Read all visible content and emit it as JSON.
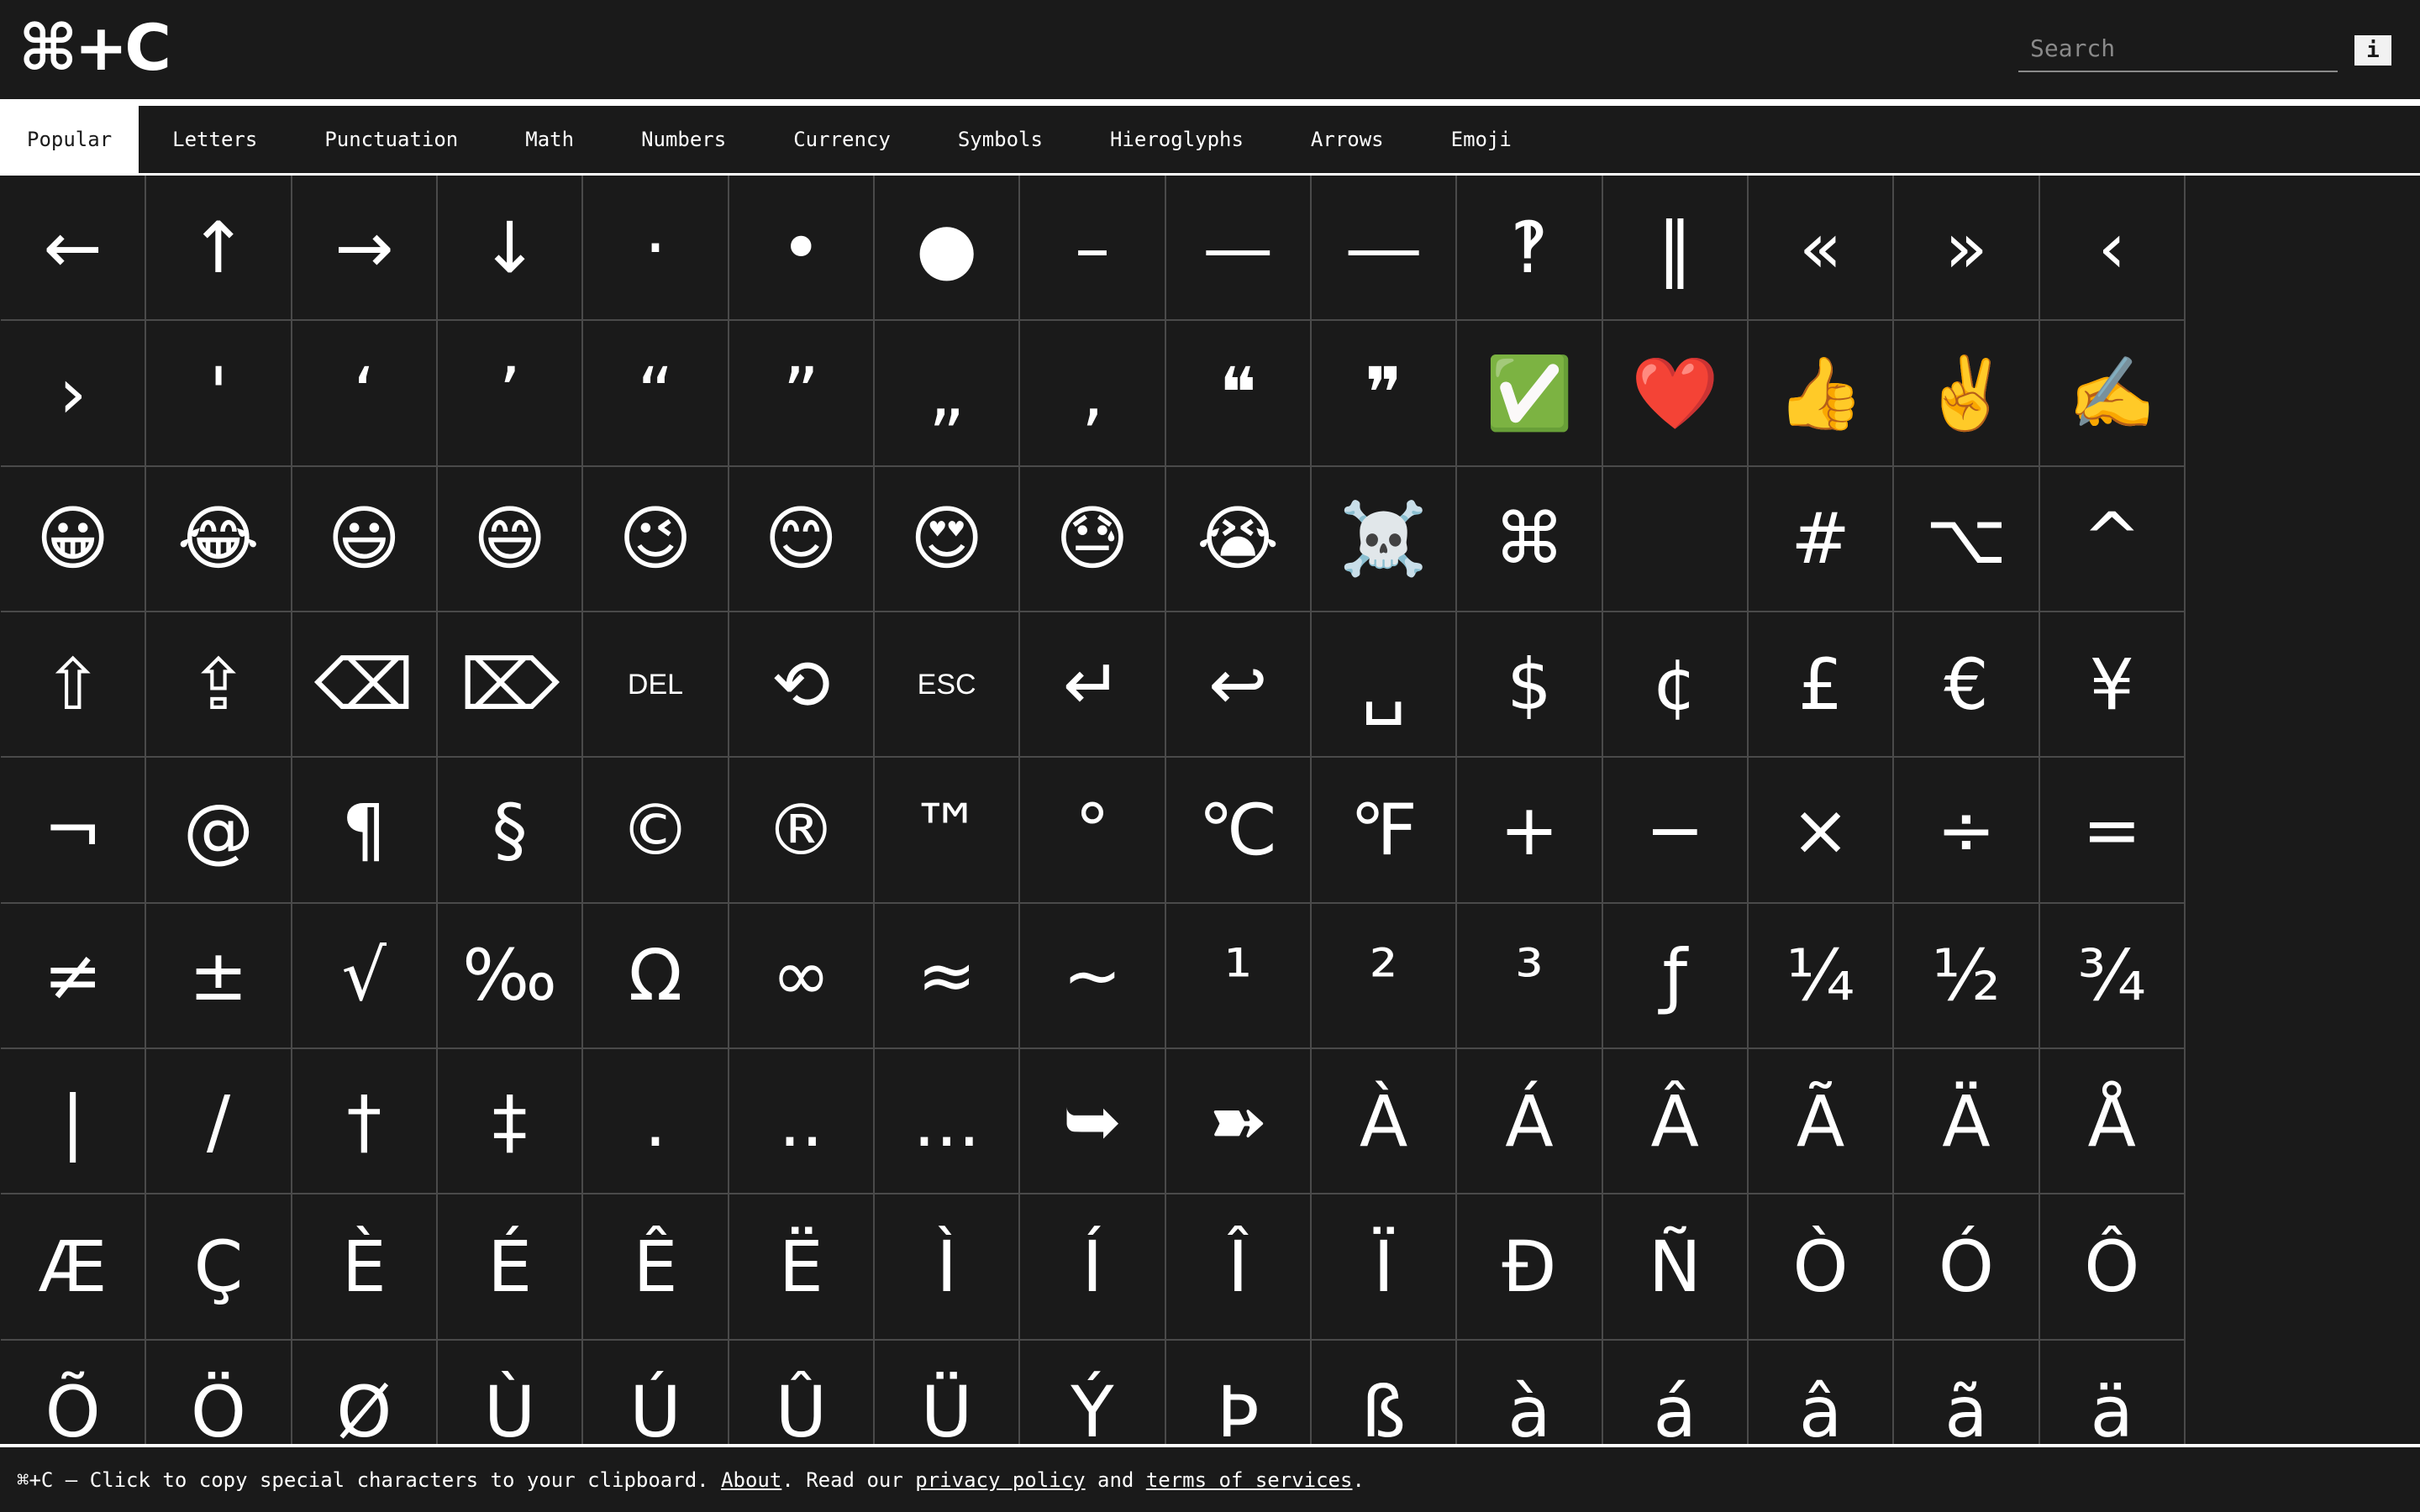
{
  "header": {
    "logo": "⌘+C",
    "search_placeholder": "Search",
    "info_label": "i"
  },
  "tabs": [
    {
      "label": "Popular",
      "active": true
    },
    {
      "label": "Letters"
    },
    {
      "label": "Punctuation"
    },
    {
      "label": "Math"
    },
    {
      "label": "Numbers"
    },
    {
      "label": "Currency"
    },
    {
      "label": "Symbols"
    },
    {
      "label": "Hieroglyphs"
    },
    {
      "label": "Arrows"
    },
    {
      "label": "Emoji"
    }
  ],
  "characters": [
    "←",
    "↑",
    "→",
    "↓",
    "·",
    "•",
    "●",
    "–",
    "—",
    "―",
    "‽",
    "‖",
    "«",
    "»",
    "‹",
    "›",
    "'",
    "‘",
    "’",
    "“",
    "”",
    "„",
    "‚",
    "❝",
    "❞",
    "✅",
    "❤️",
    "👍",
    "✌️",
    "✍️",
    "😀",
    "😂",
    "😃",
    "😄",
    "😉",
    "😊",
    "😍",
    "😓",
    "😭",
    "☠️",
    "⌘",
    "",
    "#",
    "⌥",
    "^",
    "⇧",
    "⇪",
    "⌫",
    "⌦",
    "DEL",
    "⟲",
    "ESC",
    "↵",
    "↩",
    "␣",
    "$",
    "¢",
    "£",
    "€",
    "¥",
    "¬",
    "@",
    "¶",
    "§",
    "©",
    "®",
    "™",
    "°",
    "℃",
    "℉",
    "+",
    "−",
    "×",
    "÷",
    "=",
    "≠",
    "±",
    "√",
    "‰",
    "Ω",
    "∞",
    "≈",
    "~",
    "¹",
    "²",
    "³",
    "ƒ",
    "¼",
    "½",
    "¾",
    "|",
    "/",
    "†",
    "‡",
    ".",
    "..",
    "...",
    "➥",
    "➽",
    "À",
    "Á",
    "Â",
    "Ã",
    "Ä",
    "Å",
    "Æ",
    "Ç",
    "È",
    "É",
    "Ê",
    "Ë",
    "Ì",
    "Í",
    "Î",
    "Ï",
    "Ð",
    "Ñ",
    "Ò",
    "Ó",
    "Ô",
    "Õ",
    "Ö",
    "Ø",
    "Ù",
    "Ú",
    "Û",
    "Ü",
    "Ý",
    "Þ",
    "ß",
    "à",
    "á",
    "â",
    "ã",
    "ä"
  ],
  "footer": {
    "text_1": "⌘+C – Click to copy special characters to your clipboard. ",
    "about_link": "About",
    "text_2": ". Read our ",
    "privacy_link": "privacy policy",
    "text_3": " and ",
    "terms_link": "terms of services",
    "text_4": "."
  }
}
